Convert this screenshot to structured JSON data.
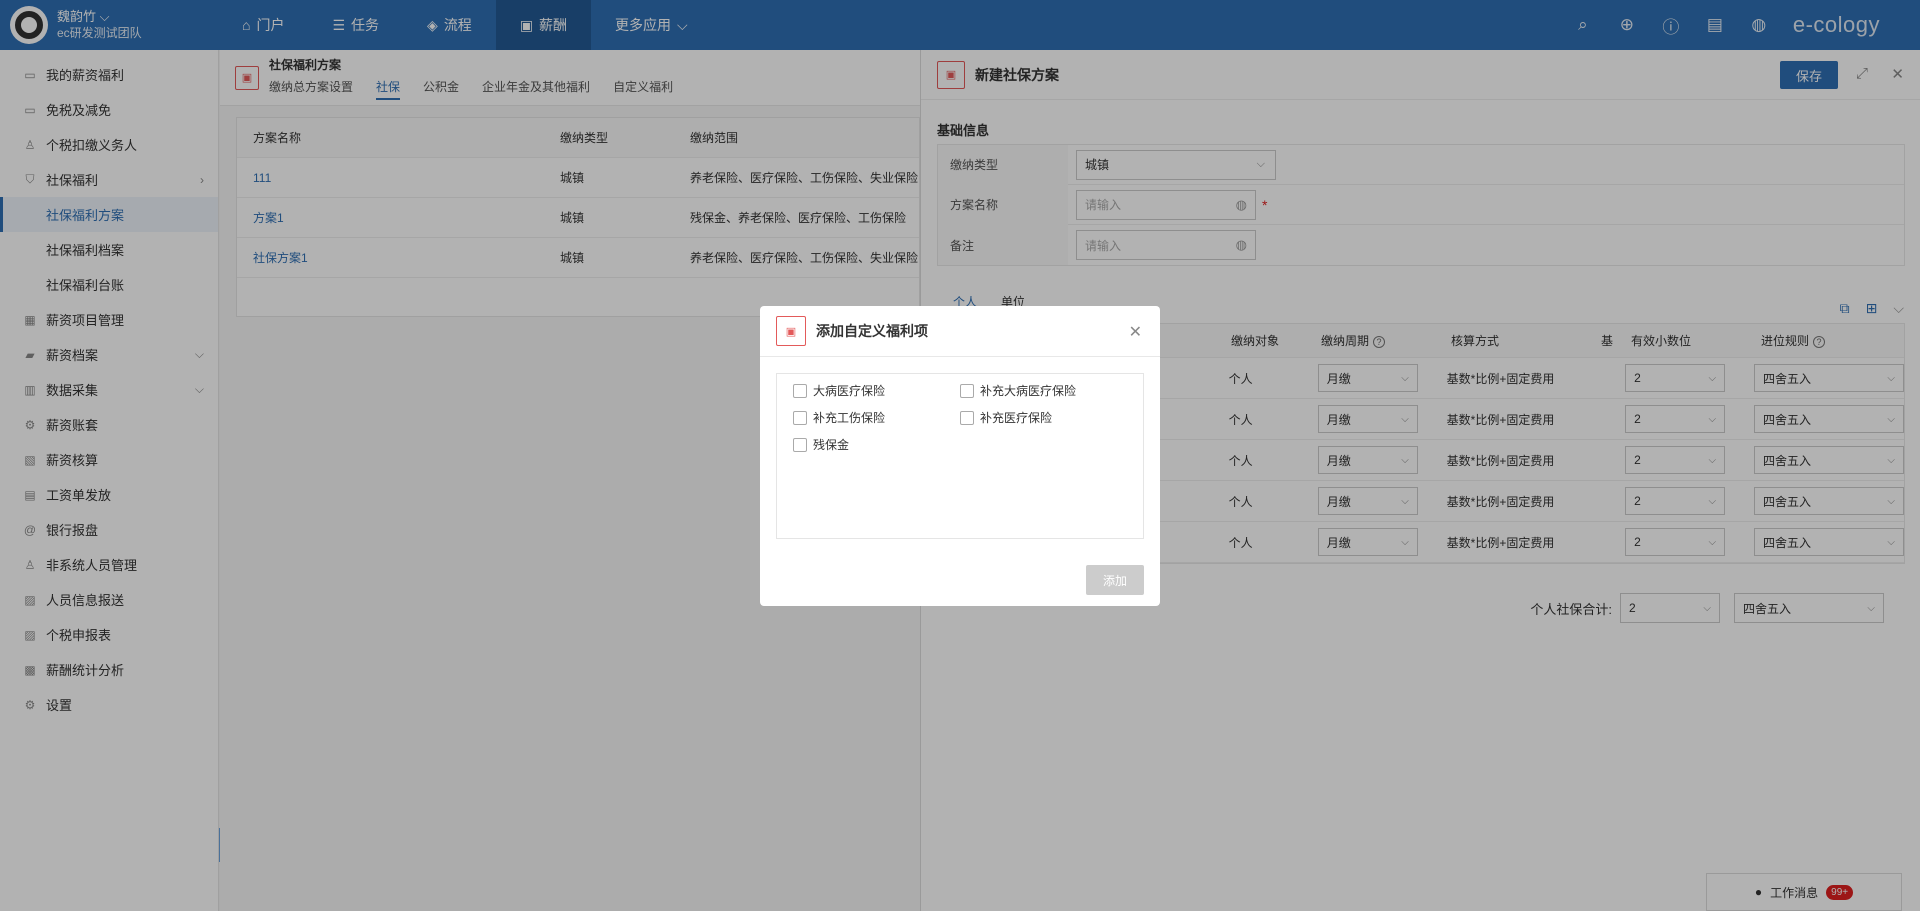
{
  "header": {
    "user_name": "魏韵竹",
    "team": "ec研发测试团队",
    "nav": [
      {
        "label": "门户",
        "icon": "home-icon"
      },
      {
        "label": "任务",
        "icon": "list-icon"
      },
      {
        "label": "流程",
        "icon": "layers-icon"
      },
      {
        "label": "薪酬",
        "icon": "money-icon"
      },
      {
        "label": "更多应用",
        "icon": "chevron-down-icon"
      }
    ],
    "logo": "e-cology"
  },
  "sidebar": {
    "items": [
      {
        "label": "我的薪资福利"
      },
      {
        "label": "免税及减免"
      },
      {
        "label": "个税扣缴义务人"
      },
      {
        "label": "社保福利"
      },
      {
        "label": "社保福利方案"
      },
      {
        "label": "社保福利档案"
      },
      {
        "label": "社保福利台账"
      },
      {
        "label": "薪资项目管理"
      },
      {
        "label": "薪资档案"
      },
      {
        "label": "数据采集"
      },
      {
        "label": "薪资账套"
      },
      {
        "label": "薪资核算"
      },
      {
        "label": "工资单发放"
      },
      {
        "label": "银行报盘"
      },
      {
        "label": "非系统人员管理"
      },
      {
        "label": "人员信息报送"
      },
      {
        "label": "个税申报表"
      },
      {
        "label": "薪酬统计分析"
      },
      {
        "label": "设置"
      }
    ]
  },
  "main": {
    "title": "社保福利方案",
    "tabs": [
      "缴纳总方案设置",
      "社保",
      "公积金",
      "企业年金及其他福利",
      "自定义福利"
    ],
    "columns": [
      "方案名称",
      "缴纳类型",
      "缴纳范围"
    ],
    "rows": [
      {
        "name": "111",
        "type": "城镇",
        "range": "养老保险、医疗保险、工伤保险、失业保险"
      },
      {
        "name": "方案1",
        "type": "城镇",
        "range": "残保金、养老保险、医疗保险、工伤保险"
      },
      {
        "name": "社保方案1",
        "type": "城镇",
        "range": "养老保险、医疗保险、工伤保险、失业保险"
      }
    ]
  },
  "panel": {
    "title": "新建社保方案",
    "save_label": "保存",
    "section_title": "基础信息",
    "fields": {
      "type_label": "缴纳类型",
      "type_value": "城镇",
      "name_label": "方案名称",
      "name_placeholder": "请输入",
      "note_label": "备注",
      "note_placeholder": "请输入",
      "required_mark": "*"
    },
    "sub_tabs": [
      "个人",
      "单位"
    ],
    "grid_headers": {
      "object": "缴纳对象",
      "period": "缴纳周期",
      "method": "核算方式",
      "base": "基",
      "decimals": "有效小数位",
      "rounding": "进位规则"
    },
    "grid_rows": [
      {
        "object": "个人",
        "period": "月缴",
        "method": "基数*比例+固定费用",
        "decimals": "2",
        "rounding": "四舍五入"
      },
      {
        "object": "个人",
        "period": "月缴",
        "method": "基数*比例+固定费用",
        "decimals": "2",
        "rounding": "四舍五入"
      },
      {
        "object": "个人",
        "period": "月缴",
        "method": "基数*比例+固定费用",
        "decimals": "2",
        "rounding": "四舍五入"
      },
      {
        "object": "个人",
        "period": "月缴",
        "method": "基数*比例+固定费用",
        "decimals": "2",
        "rounding": "四舍五入"
      },
      {
        "object": "个人",
        "period": "月缴",
        "method": "基数*比例+固定费用",
        "decimals": "2",
        "rounding": "四舍五入"
      }
    ],
    "total_label": "个人社保合计:",
    "total_decimals": "2",
    "total_rounding": "四舍五入"
  },
  "modal": {
    "title": "添加自定义福利项",
    "options": [
      "大病医疗保险",
      "补充大病医疗保险",
      "补充工伤保险",
      "补充医疗保险",
      "残保金"
    ],
    "add_label": "添加"
  },
  "message": {
    "label": "工作消息",
    "badge": "99+"
  }
}
